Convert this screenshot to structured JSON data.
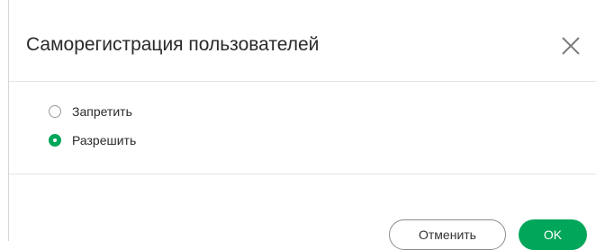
{
  "dialog": {
    "title": "Саморегистрация пользователей",
    "close_icon": "close-icon",
    "options": [
      {
        "label": "Запретить",
        "selected": false
      },
      {
        "label": "Разрешить",
        "selected": true
      }
    ],
    "cancel_label": "Отменить",
    "ok_label": "OK",
    "accent_color": "#00a65a"
  }
}
